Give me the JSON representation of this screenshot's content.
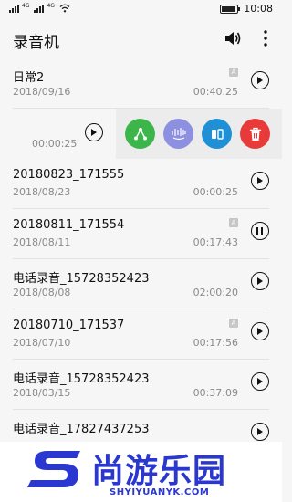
{
  "status_bar": {
    "time": "10:08"
  },
  "app_bar": {
    "title": "录音机"
  },
  "recordings": [
    {
      "title": "日常2",
      "date": "2018/09/16",
      "duration": "00:40.25",
      "badge": "A",
      "state": "play"
    },
    {
      "title": "",
      "date": "",
      "duration": "00:00:25",
      "badge": "",
      "state": "play"
    },
    {
      "title": "20180823_171555",
      "date": "2018/08/23",
      "duration": "00:00:25",
      "badge": "",
      "state": "play"
    },
    {
      "title": "20180811_171554",
      "date": "2018/08/11",
      "duration": "00:17:43",
      "badge": "A",
      "state": "pause"
    },
    {
      "title": "电话录音_15728352423",
      "date": "2018/08/08",
      "duration": "02:00:20",
      "badge": "",
      "state": "play"
    },
    {
      "title": "20180710_171537",
      "date": "2018/07/10",
      "duration": "00:17:56",
      "badge": "A",
      "state": "play"
    },
    {
      "title": "电话录音_15728352423",
      "date": "2018/03/15",
      "duration": "00:37:09",
      "badge": "",
      "state": "play"
    },
    {
      "title": "电话录音_17827437253",
      "date": "",
      "duration": "",
      "badge": "",
      "state": "play"
    }
  ],
  "swipe_actions": [
    {
      "icon": "share-icon",
      "color": "#3cb54a"
    },
    {
      "icon": "edit-clip-icon",
      "color": "#8d8fe0"
    },
    {
      "icon": "convert-icon",
      "color": "#1f8fd6"
    },
    {
      "icon": "delete-icon",
      "color": "#e93a3a"
    }
  ],
  "watermark": {
    "name_cn": "尚游乐园",
    "name_en": "SHYIYUANYK.COM"
  }
}
